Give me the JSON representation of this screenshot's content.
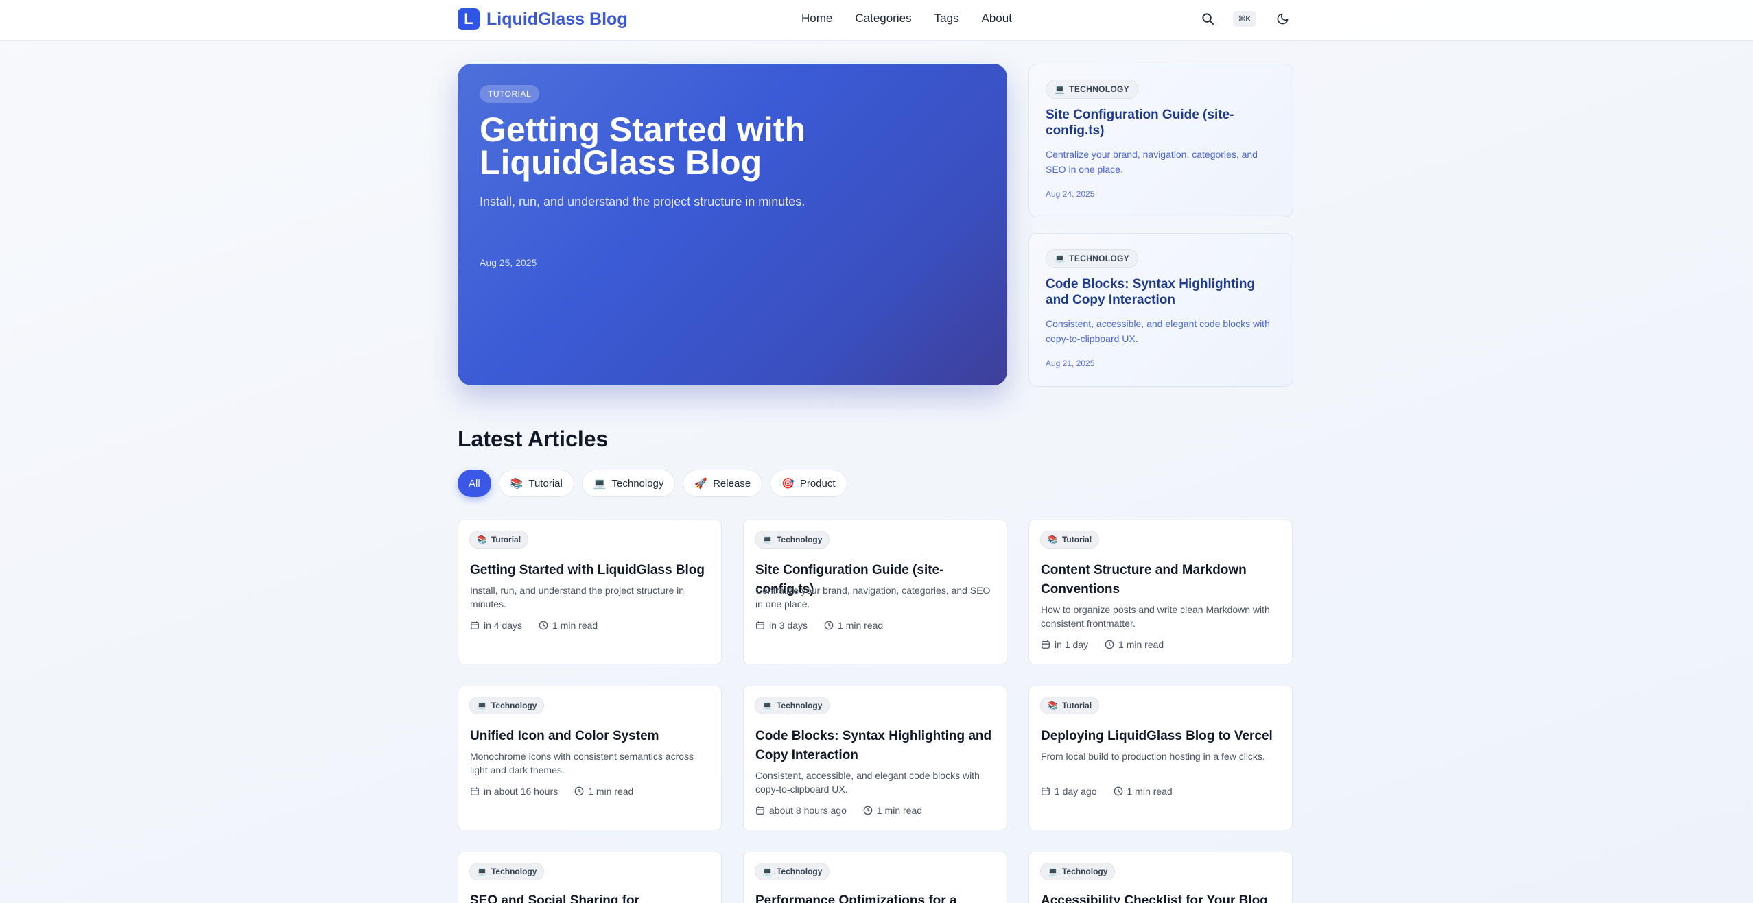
{
  "header": {
    "logo_letter": "L",
    "logo_text": "LiquidGlass Blog",
    "nav": [
      "Home",
      "Categories",
      "Tags",
      "About"
    ],
    "shortcut": "⌘K"
  },
  "hero": {
    "badge": "TUTORIAL",
    "title": "Getting Started with LiquidGlass Blog",
    "subtitle": "Install, run, and understand the project structure in minutes.",
    "date": "Aug 25, 2025"
  },
  "featured": [
    {
      "badge_icon": "💻",
      "badge": "TECHNOLOGY",
      "title": "Site Configuration Guide (site-config.ts)",
      "desc": "Centralize your brand, navigation, categories, and SEO in one place.",
      "date": "Aug 24, 2025"
    },
    {
      "badge_icon": "💻",
      "badge": "TECHNOLOGY",
      "title": "Code Blocks: Syntax Highlighting and Copy Interaction",
      "desc": "Consistent, accessible, and elegant code blocks with copy-to-clipboard UX.",
      "date": "Aug 21, 2025"
    }
  ],
  "latest": {
    "title": "Latest Articles",
    "filters": [
      {
        "icon": "",
        "label": "All"
      },
      {
        "icon": "📚",
        "label": "Tutorial"
      },
      {
        "icon": "💻",
        "label": "Technology"
      },
      {
        "icon": "🚀",
        "label": "Release"
      },
      {
        "icon": "🎯",
        "label": "Product"
      }
    ],
    "articles": [
      {
        "icon": "📚",
        "category": "Tutorial",
        "title": "Getting Started with LiquidGlass Blog",
        "desc": "Install, run, and understand the project structure in minutes.",
        "time": "in 4 days",
        "read": "1 min read"
      },
      {
        "icon": "💻",
        "category": "Technology",
        "title": "Site Configuration Guide (site-config.ts)",
        "desc": "Centralize your brand, navigation, categories, and SEO in one place.",
        "time": "in 3 days",
        "read": "1 min read"
      },
      {
        "icon": "📚",
        "category": "Tutorial",
        "title": "Content Structure and Markdown Conventions",
        "desc": "How to organize posts and write clean Markdown with consistent frontmatter.",
        "time": "in 1 day",
        "read": "1 min read"
      },
      {
        "icon": "💻",
        "category": "Technology",
        "title": "Unified Icon and Color System",
        "desc": "Monochrome icons with consistent semantics across light and dark themes.",
        "time": "in about 16 hours",
        "read": "1 min read"
      },
      {
        "icon": "💻",
        "category": "Technology",
        "title": "Code Blocks: Syntax Highlighting and Copy Interaction",
        "desc": "Consistent, accessible, and elegant code blocks with copy-to-clipboard UX.",
        "time": "about 8 hours ago",
        "read": "1 min read"
      },
      {
        "icon": "📚",
        "category": "Tutorial",
        "title": "Deploying LiquidGlass Blog to Vercel",
        "desc": "From local build to production hosting in a few clicks.",
        "time": "1 day ago",
        "read": "1 min read"
      },
      {
        "icon": "💻",
        "category": "Technology",
        "title": "SEO and Social Sharing for LiquidGlass",
        "desc": "",
        "time": "",
        "read": ""
      },
      {
        "icon": "💻",
        "category": "Technology",
        "title": "Performance Optimizations for a",
        "desc": "",
        "time": "",
        "read": ""
      },
      {
        "icon": "💻",
        "category": "Technology",
        "title": "Accessibility Checklist for Your Blog",
        "desc": "",
        "time": "",
        "read": ""
      }
    ]
  },
  "colors": {
    "brand": "#2f55e4",
    "hero_start": "#4d70db",
    "hero_end": "#3e3f99",
    "accent_text": "#1e3a8a"
  }
}
